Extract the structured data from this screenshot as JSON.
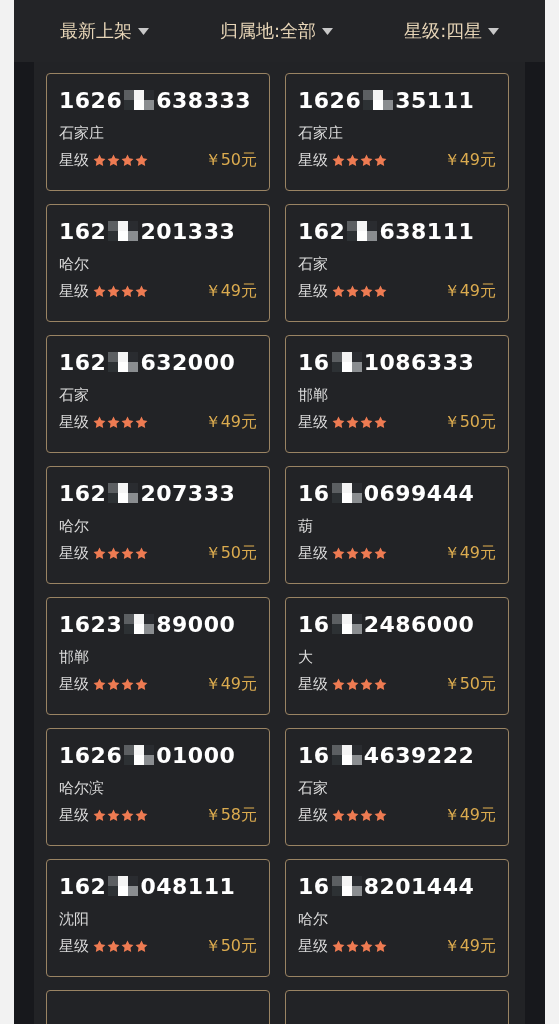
{
  "filters": [
    {
      "label": "最新上架"
    },
    {
      "label": "归属地:全部"
    },
    {
      "label": "星级:四星"
    }
  ],
  "listings": [
    {
      "number_start": "1626",
      "number_end": "638333",
      "city": "石家庄",
      "rating_label": "星级",
      "stars": 4,
      "price": "￥50元"
    },
    {
      "number_start": "1626",
      "number_end": "35111",
      "city": "石家庄",
      "rating_label": "星级",
      "stars": 4,
      "price": "￥49元"
    },
    {
      "number_start": "162",
      "number_end": "201333",
      "city": "哈尔",
      "rating_label": "星级",
      "stars": 4,
      "price": "￥49元"
    },
    {
      "number_start": "162",
      "number_end": "638111",
      "city": "石家",
      "rating_label": "星级",
      "stars": 4,
      "price": "￥49元"
    },
    {
      "number_start": "162",
      "number_end": "632000",
      "city": "石家",
      "rating_label": "星级",
      "stars": 4,
      "price": "￥49元"
    },
    {
      "number_start": "16",
      "number_end": "1086333",
      "city": "邯郸",
      "rating_label": "星级",
      "stars": 4,
      "price": "￥50元"
    },
    {
      "number_start": "162",
      "number_end": "207333",
      "city": "哈尔",
      "rating_label": "星级",
      "stars": 4,
      "price": "￥50元"
    },
    {
      "number_start": "16",
      "number_end": "0699444",
      "city": "葫",
      "rating_label": "星级",
      "stars": 4,
      "price": "￥49元"
    },
    {
      "number_start": "1623",
      "number_end": "89000",
      "city": "邯郸",
      "rating_label": "星级",
      "stars": 4,
      "price": "￥49元"
    },
    {
      "number_start": "16",
      "number_end": "2486000",
      "city": "大",
      "rating_label": "星级",
      "stars": 4,
      "price": "￥50元"
    },
    {
      "number_start": "1626",
      "number_end": "01000",
      "city": "哈尔滨",
      "rating_label": "星级",
      "stars": 4,
      "price": "￥58元"
    },
    {
      "number_start": "16",
      "number_end": "4639222",
      "city": "石家",
      "rating_label": "星级",
      "stars": 4,
      "price": "￥49元"
    },
    {
      "number_start": "162",
      "number_end": "048111",
      "city": "沈阳",
      "rating_label": "星级",
      "stars": 4,
      "price": "￥50元"
    },
    {
      "number_start": "16",
      "number_end": "8201444",
      "city": "哈尔",
      "rating_label": "星级",
      "stars": 4,
      "price": "￥49元"
    },
    {
      "kind": "cut"
    },
    {
      "kind": "cut"
    }
  ]
}
